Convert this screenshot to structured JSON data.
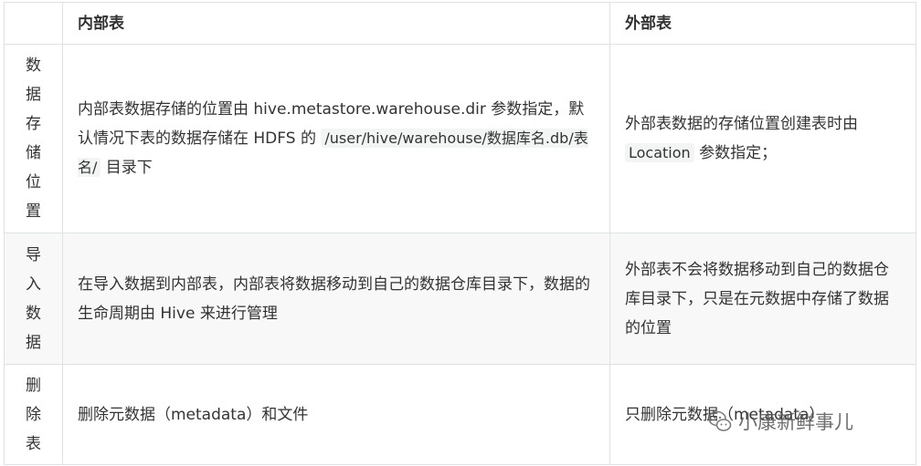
{
  "table": {
    "headers": [
      "",
      "内部表",
      "外部表"
    ],
    "rows": [
      {
        "label": [
          "数",
          "据",
          "存",
          "储",
          "位",
          "置"
        ],
        "internal": {
          "text1": "内部表数据存储的位置由 hive.metastore.warehouse.dir 参数指定，默认情况下表的数据存储在 HDFS 的 ",
          "code": "/user/hive/warehouse/数据库名.db/表名/",
          "text2": " 目录下"
        },
        "external": {
          "text1": "外部表数据的存储位置创建表时由 ",
          "code": "Location",
          "text2": " 参数指定；"
        }
      },
      {
        "label": [
          "导",
          "入",
          "数",
          "据"
        ],
        "internal": {
          "text": "在导入数据到内部表，内部表将数据移动到自己的数据仓库目录下，数据的生命周期由 Hive 来进行管理"
        },
        "external": {
          "text": "外部表不会将数据移动到自己的数据仓库目录下，只是在元数据中存储了数据的位置"
        }
      },
      {
        "label": [
          "删",
          "除",
          "表"
        ],
        "internal": {
          "text": "删除元数据（metadata）和文件"
        },
        "external": {
          "text": "只删除元数据（metadata）"
        }
      }
    ]
  },
  "watermark": {
    "text": "小康新鲜事儿",
    "icon": "wechat-icon"
  }
}
